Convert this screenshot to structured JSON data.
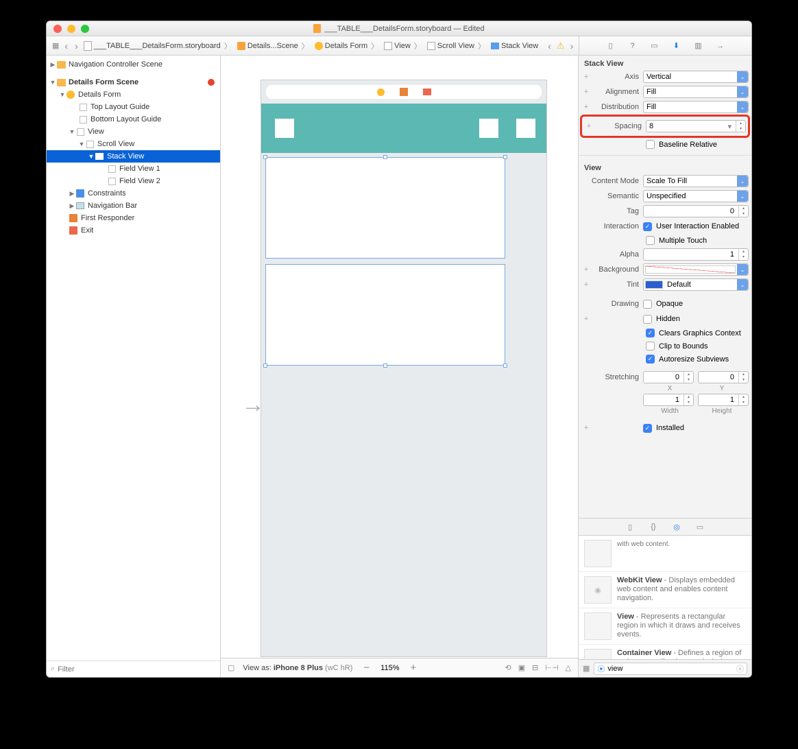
{
  "window": {
    "title": "___TABLE___DetailsForm.storyboard — Edited"
  },
  "breadcrumb": {
    "file": "___TABLE___DetailsForm.storyboard",
    "scene": "Details...Scene",
    "vc": "Details Form",
    "view": "View",
    "scroll": "Scroll View",
    "stack": "Stack View"
  },
  "navigator": {
    "groups": [
      {
        "label": "Navigation Controller Scene"
      },
      {
        "label": "Details Form Scene"
      }
    ],
    "df": {
      "vc": "Details Form",
      "top": "Top Layout Guide",
      "bottom": "Bottom Layout Guide",
      "view": "View",
      "scroll": "Scroll View",
      "stack": "Stack View",
      "fv1": "Field View 1",
      "fv2": "Field View 2",
      "constraints": "Constraints",
      "navbar": "Navigation Bar",
      "responder": "First Responder",
      "exit": "Exit"
    },
    "filter_placeholder": "Filter"
  },
  "canvas": {
    "view_as_label": "View as:",
    "device": "iPhone 8 Plus",
    "size_classes": "(wC hR)",
    "zoom": "115%"
  },
  "inspector": {
    "stack_view": {
      "title": "Stack View",
      "axis_label": "Axis",
      "axis": "Vertical",
      "alignment_label": "Alignment",
      "alignment": "Fill",
      "distribution_label": "Distribution",
      "distribution": "Fill",
      "spacing_label": "Spacing",
      "spacing": "8",
      "baseline": "Baseline Relative"
    },
    "view": {
      "title": "View",
      "content_mode_label": "Content Mode",
      "content_mode": "Scale To Fill",
      "semantic_label": "Semantic",
      "semantic": "Unspecified",
      "tag_label": "Tag",
      "tag": "0",
      "interaction_label": "Interaction",
      "uie": "User Interaction Enabled",
      "mt": "Multiple Touch",
      "alpha_label": "Alpha",
      "alpha": "1",
      "background_label": "Background",
      "tint_label": "Tint",
      "tint": "Default",
      "drawing_label": "Drawing",
      "opaque": "Opaque",
      "hidden": "Hidden",
      "cgc": "Clears Graphics Context",
      "ctb": "Clip to Bounds",
      "asv": "Autoresize Subviews",
      "stretching_label": "Stretching",
      "sx": "0",
      "sy": "0",
      "sw": "1",
      "sh": "1",
      "x": "X",
      "y": "Y",
      "w": "Width",
      "h": "Height",
      "installed": "Installed"
    }
  },
  "library": {
    "wc_snip": "with web content.",
    "wk_title": "WebKit View",
    "wk_desc": " - Displays embedded web content and enables content navigation.",
    "v_title": "View",
    "v_desc": " - Represents a rectangular region in which it draws and receives events.",
    "cv_title": "Container View",
    "cv_desc": " - Defines a region of a view controller that can include a child view controller.",
    "search": "view"
  }
}
